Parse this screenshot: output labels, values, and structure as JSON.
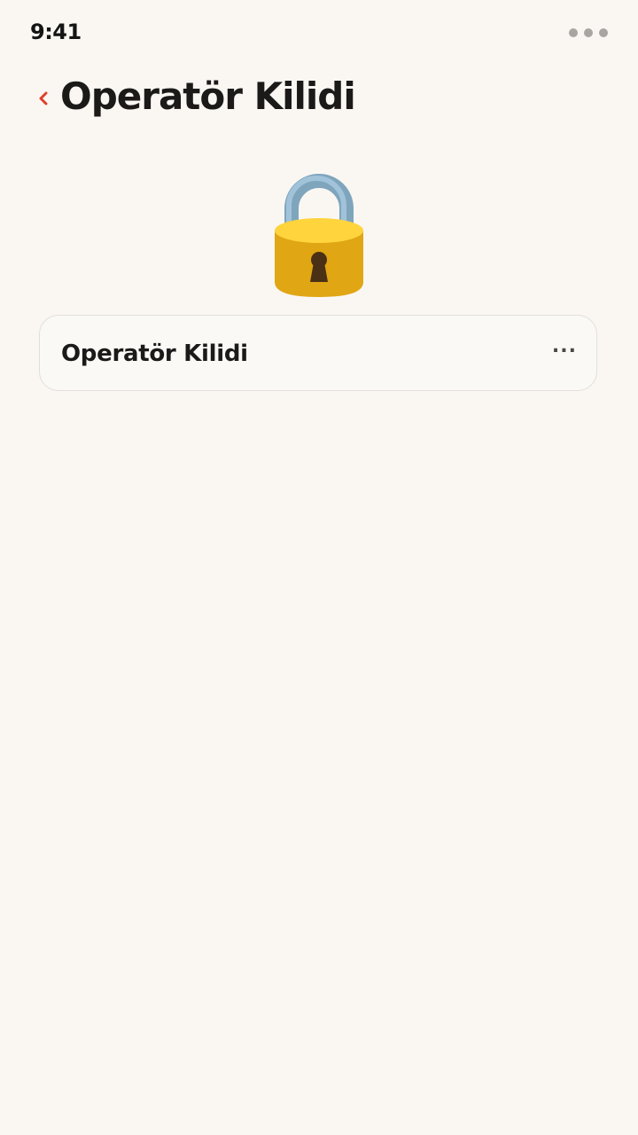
{
  "status_bar": {
    "time": "9:41",
    "menu_icon": "more-dots-icon"
  },
  "header": {
    "back_icon": "chevron-left-icon",
    "title": "Operatör Kilidi",
    "accent_color": "#e0402a"
  },
  "hero": {
    "icon": "padlock-icon"
  },
  "settings": {
    "items": [
      {
        "label": "Operatör Kilidi",
        "value": "..."
      }
    ]
  }
}
